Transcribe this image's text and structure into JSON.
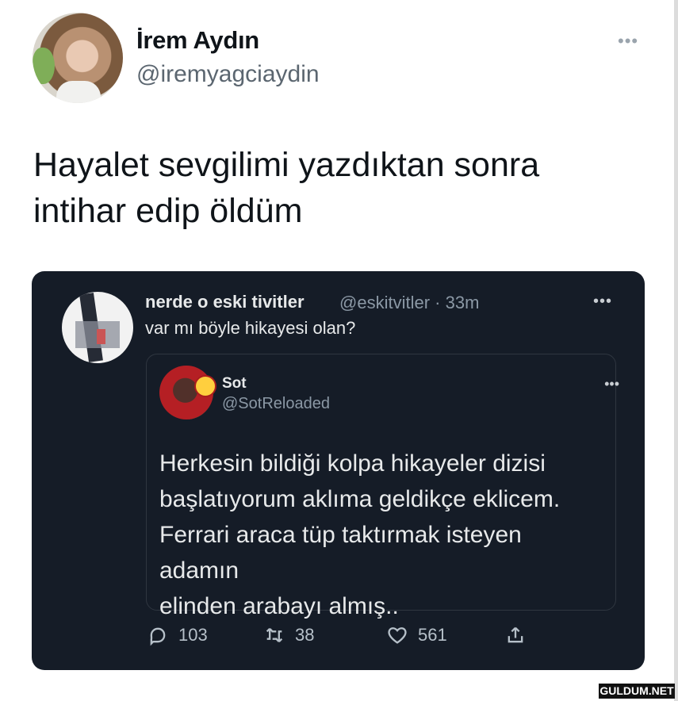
{
  "author": {
    "name": "İrem Aydın",
    "handle": "@iremyagciaydin"
  },
  "tweet": {
    "text_line1": "Hayalet sevgilimi yazdıktan sonra",
    "text_line2": "intihar edip öldüm"
  },
  "quoted": {
    "name": "nerde o eski tivitler",
    "handle": "@eskitvitler",
    "time": "· 33m",
    "text": "var mı böyle hikayesi olan?",
    "inner": {
      "name": "Sot",
      "handle": "@SotReloaded",
      "line1": "Herkesin bildiği kolpa hikayeler dizisi",
      "line2": "başlatıyorum aklıma geldikçe eklicem.",
      "line3": "Ferrari araca tüp taktırmak isteyen adamın",
      "line4": "elinden arabayı almış.."
    },
    "stats": {
      "replies": "103",
      "retweets": "38",
      "likes": "561"
    }
  },
  "icons": {
    "more": "more-icon",
    "reply": "reply-icon",
    "retweet": "retweet-icon",
    "like": "heart-icon",
    "share": "share-icon"
  },
  "watermark": "GULDUM.NET"
}
